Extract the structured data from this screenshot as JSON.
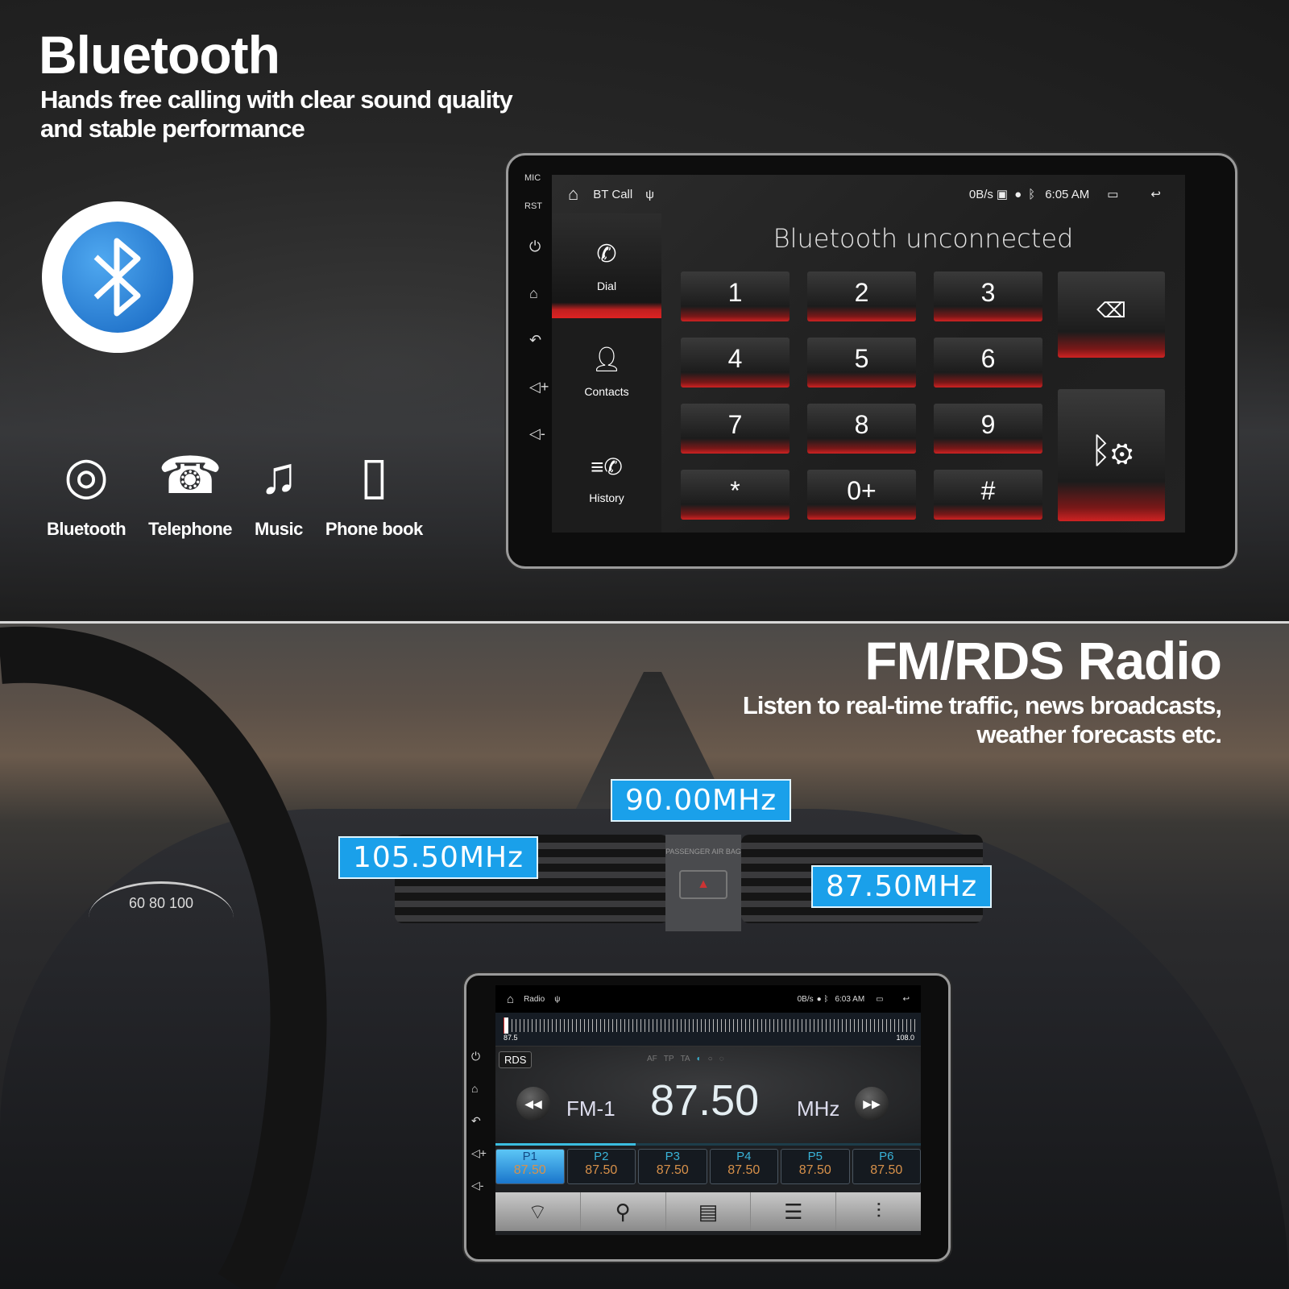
{
  "bluetooth_section": {
    "title": "Bluetooth",
    "subtitle_line1": "Hands free calling with clear sound quality",
    "subtitle_line2": "and stable performance",
    "features": [
      {
        "icon": "bluetooth-signal-icon",
        "label": "Bluetooth"
      },
      {
        "icon": "telephone-icon",
        "label": "Telephone"
      },
      {
        "icon": "music-icon",
        "label": "Music"
      },
      {
        "icon": "phone-book-icon",
        "label": "Phone book"
      }
    ]
  },
  "bt_screen": {
    "hw_labels": {
      "mic": "MIC",
      "rst": "RST"
    },
    "status": {
      "app": "BT Call",
      "speed": "0B/s",
      "time": "6:05 AM"
    },
    "heading": "Bluetooth unconnected",
    "nav": [
      {
        "label": "Dial",
        "icon": "phone-icon",
        "active": true
      },
      {
        "label": "Contacts",
        "icon": "contact-icon"
      },
      {
        "label": "History",
        "icon": "call-history-icon"
      }
    ],
    "keys": [
      "1",
      "2",
      "3",
      "4",
      "5",
      "6",
      "7",
      "8",
      "9",
      "*",
      "0+",
      "#"
    ],
    "accent": "#d02222"
  },
  "radio_section": {
    "title": "FM/RDS Radio",
    "subtitle_line1": "Listen to real-time traffic, news broadcasts,",
    "subtitle_line2": "weather forecasts etc.",
    "callouts": [
      "90.00MHz",
      "105.50MHz",
      "87.50MHz"
    ],
    "callout_color": "#1aa0ea",
    "airbag_label": "PASSENGER AIR BAG"
  },
  "radio_screen": {
    "status": {
      "app": "Radio",
      "speed": "0B/s",
      "time": "6:03 AM"
    },
    "scale_min": "87.5",
    "scale_max": "108.0",
    "rds_label": "RDS",
    "flags": [
      "AF",
      "TP",
      "TA"
    ],
    "band": "FM-1",
    "frequency": "87.50",
    "unit": "MHz",
    "presets": [
      {
        "label": "P1",
        "value": "87.50",
        "active": true
      },
      {
        "label": "P2",
        "value": "87.50"
      },
      {
        "label": "P3",
        "value": "87.50"
      },
      {
        "label": "P4",
        "value": "87.50"
      },
      {
        "label": "P5",
        "value": "87.50"
      },
      {
        "label": "P6",
        "value": "87.50"
      }
    ],
    "toolbar": [
      "signal-icon",
      "search-icon",
      "save-icon",
      "list-search-icon",
      "equalizer-icon"
    ]
  }
}
